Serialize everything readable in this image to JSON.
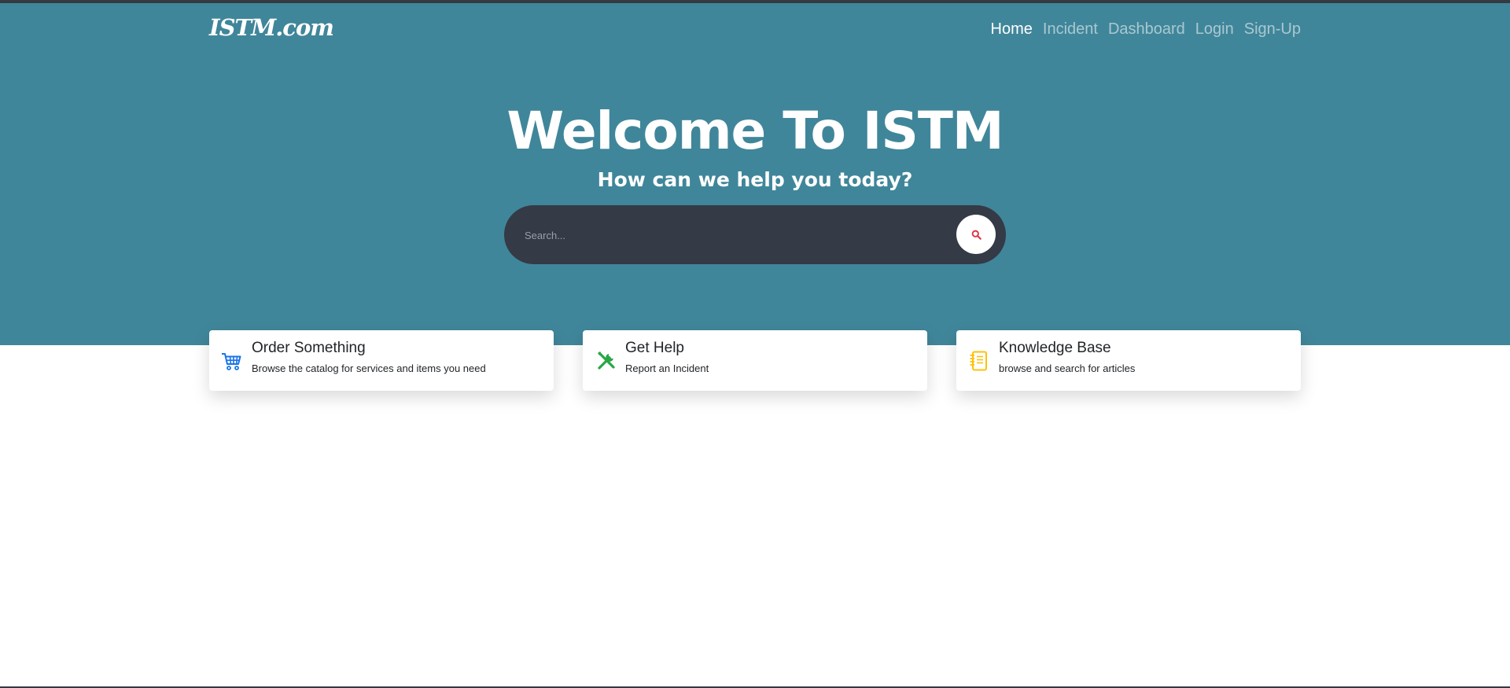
{
  "brand": "ISTM.com",
  "nav": [
    {
      "label": "Home",
      "active": true
    },
    {
      "label": "Incident",
      "active": false
    },
    {
      "label": "Dashboard",
      "active": false
    },
    {
      "label": "Login",
      "active": false
    },
    {
      "label": "Sign-Up",
      "active": false
    }
  ],
  "hero": {
    "title": "Welcome To ISTM",
    "subtitle": "How can we help you today?"
  },
  "search": {
    "placeholder": "Search..."
  },
  "cards": [
    {
      "title": "Order Something",
      "description": "Browse the catalog for services and items you need",
      "icon": "shopping-cart-icon",
      "icon_color": "#1a73e8"
    },
    {
      "title": "Get Help",
      "description": "Report an Incident",
      "icon": "tools-icon",
      "icon_color": "#28a745"
    },
    {
      "title": "Knowledge Base",
      "description": "browse and search for articles",
      "icon": "notebook-icon",
      "icon_color": "#ffc107"
    }
  ],
  "colors": {
    "hero_background": "#40869a",
    "search_background": "#343a46",
    "search_icon": "#dc3545"
  }
}
